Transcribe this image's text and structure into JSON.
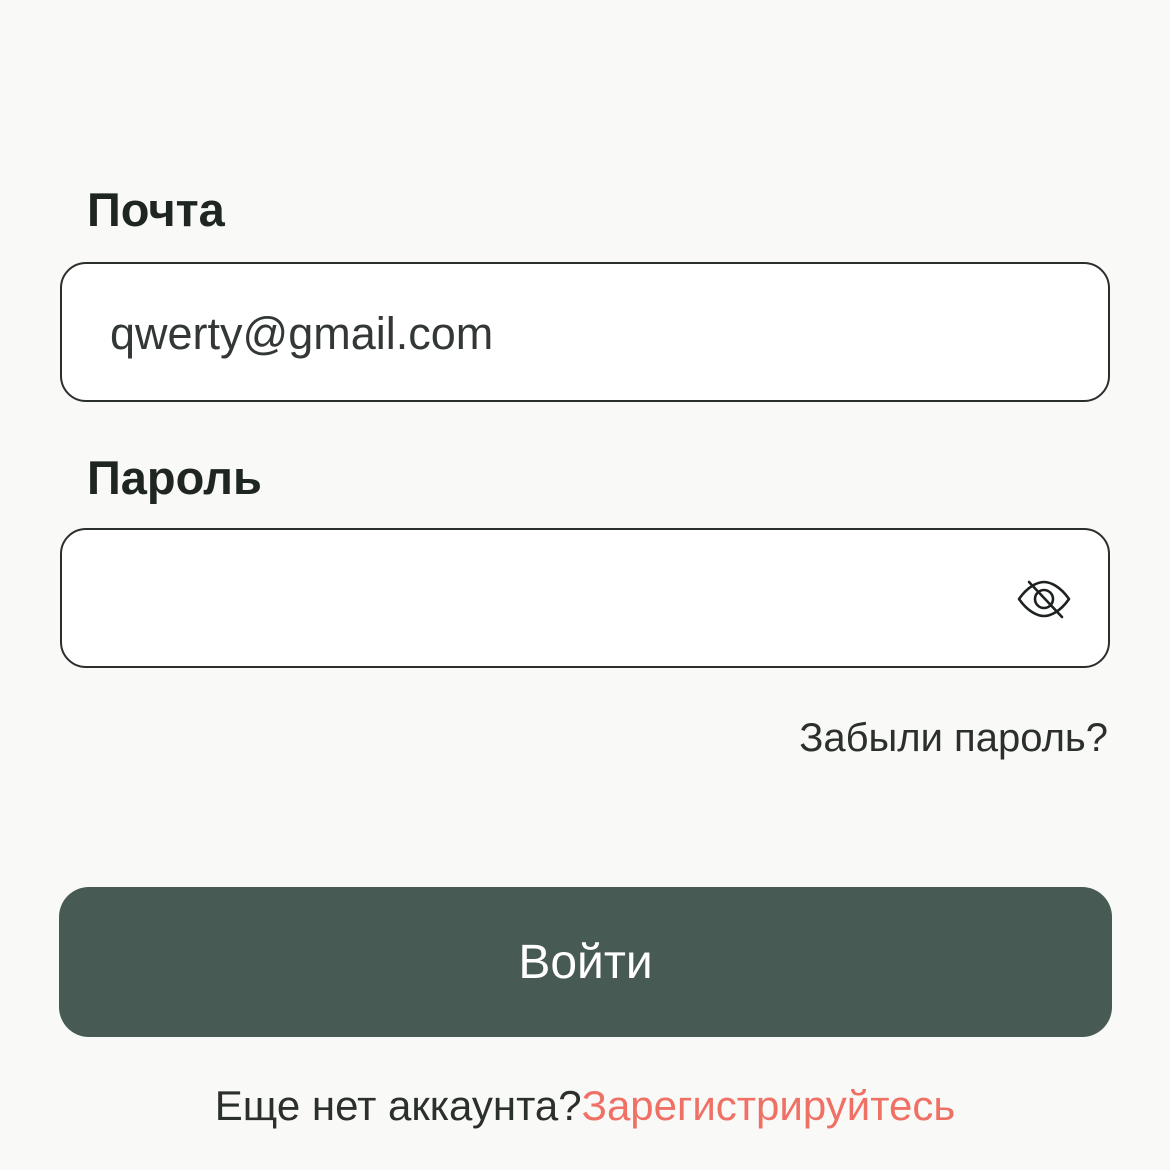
{
  "form": {
    "email_label": "Почта",
    "email_value": "qwerty@gmail.com",
    "password_label": "Пароль",
    "password_value": "",
    "password_toggle_icon": "eye-off-icon",
    "forgot_password": "Забыли пароль?",
    "submit_label": "Войти",
    "no_account_text": "Еще нет аккаунта?",
    "signup_link": "Зарегистрируйтесь"
  },
  "colors": {
    "background": "#f9f9f7",
    "button": "#475a53",
    "link_accent": "#ef7165",
    "border": "#2a2f2c"
  }
}
